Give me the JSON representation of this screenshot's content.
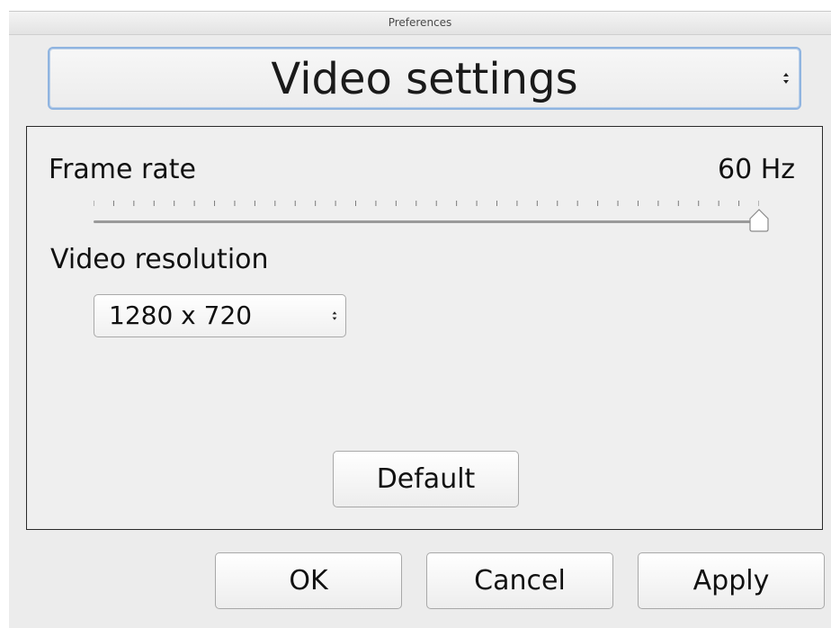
{
  "window": {
    "title": "Preferences"
  },
  "category": {
    "selected": "Video settings"
  },
  "frame_rate": {
    "label": "Frame rate",
    "value_text": "60 Hz",
    "slider_fraction": 1.0,
    "tick_count": 34
  },
  "video_resolution": {
    "label": "Video resolution",
    "selected": "1280 x 720"
  },
  "buttons": {
    "default": "Default",
    "ok": "OK",
    "cancel": "Cancel",
    "apply": "Apply"
  },
  "colors": {
    "focus_ring": "#8fb4e0",
    "window_bg": "#ececec"
  }
}
